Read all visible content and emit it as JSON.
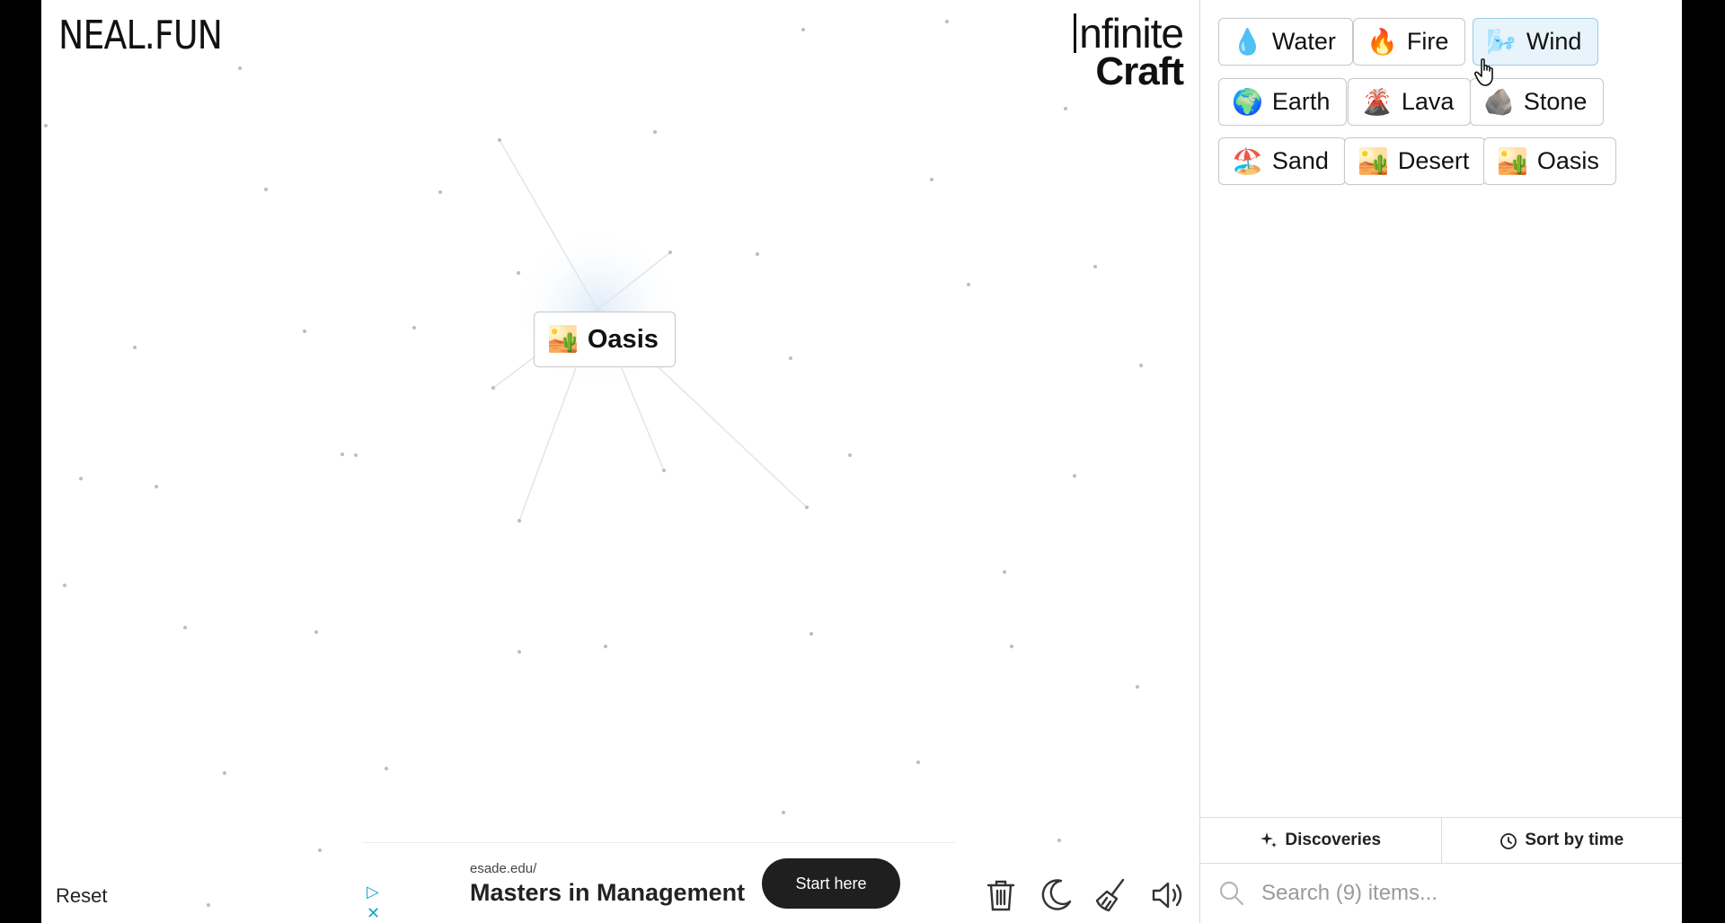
{
  "logo": "NEAL.FUN",
  "brand": {
    "top": "nfinite",
    "bottom": "Craft"
  },
  "canvas": {
    "element": {
      "emoji": "🏜️",
      "label": "Oasis"
    }
  },
  "reset_label": "Reset",
  "ad": {
    "url": "esade.edu/",
    "title": "Masters in Management",
    "cta": "Start here"
  },
  "toolbar": [
    "trash-icon",
    "moon-icon",
    "broom-icon",
    "speaker-icon"
  ],
  "sidebar": {
    "items": [
      {
        "emoji": "💧",
        "label": "Water"
      },
      {
        "emoji": "🔥",
        "label": "Fire"
      },
      {
        "emoji": "🌬️",
        "label": "Wind"
      },
      {
        "emoji": "🌍",
        "label": "Earth"
      },
      {
        "emoji": "🌋",
        "label": "Lava"
      },
      {
        "emoji": "🪨",
        "label": "Stone"
      },
      {
        "emoji": "🏖️",
        "label": "Sand"
      },
      {
        "emoji": "🏜️",
        "label": "Desert"
      },
      {
        "emoji": "🏜️",
        "label": "Oasis"
      }
    ],
    "tabs": {
      "discoveries": "Discoveries",
      "sort": "Sort by time"
    },
    "search_placeholder": "Search (9) items..."
  },
  "colors": {
    "accent": "#12a6c8",
    "chip_border": "#c9c9c9",
    "wind_highlight": "#e8f4fb"
  }
}
